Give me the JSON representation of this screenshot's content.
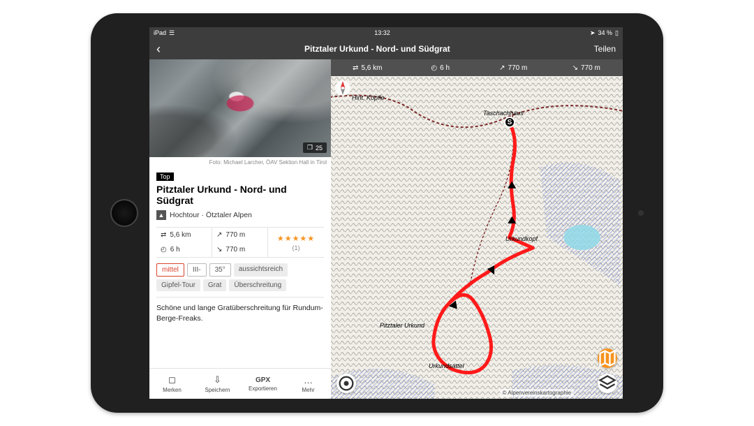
{
  "status_bar": {
    "device": "iPad",
    "time": "13:32",
    "battery": "34 %"
  },
  "nav": {
    "title": "Pitztaler Urkund - Nord- und Südgrat",
    "share": "Teilen"
  },
  "hero": {
    "photo_count": "25",
    "credit": "Foto: Michael Larcher, ÖAV Sektion Hall in Tirol"
  },
  "tour": {
    "badge": "Top",
    "title": "Pitztaler Urkund - Nord- und Südgrat",
    "type_label": "Hochtour · Ötztaler Alpen"
  },
  "stats": {
    "distance": "5,6 km",
    "duration": "6 h",
    "ascent": "770 m",
    "descent": "770 m",
    "rating_count": "(1)"
  },
  "tags": {
    "difficulty": "mittel",
    "grade": "III-",
    "slope": "35°",
    "scenic": "aussichtsreich",
    "summit": "Gipfel-Tour",
    "ridge": "Grat",
    "traverse": "Überschreitung"
  },
  "description": "Schöne und lange Gratüberschreitung für Rundum-Berge-Freaks.",
  "actions": {
    "bookmark": "Merken",
    "save": "Speichern",
    "export_top": "GPX",
    "export_bottom": "Exportieren",
    "more": "Mehr"
  },
  "map_stats": {
    "distance": "5,6 km",
    "duration": "6 h",
    "ascent": "770 m",
    "descent": "770 m"
  },
  "map_labels": {
    "taschachhaus": "Taschachhaus",
    "urkundkopf": "Urkundkopf",
    "pitztaler": "Pitztaler Urkund",
    "urkundsattel": "Urkundsattel",
    "hint_koepfle": "Hint. Köpfle",
    "start": "S",
    "attribution": "© Alpenvereinskartographie"
  }
}
